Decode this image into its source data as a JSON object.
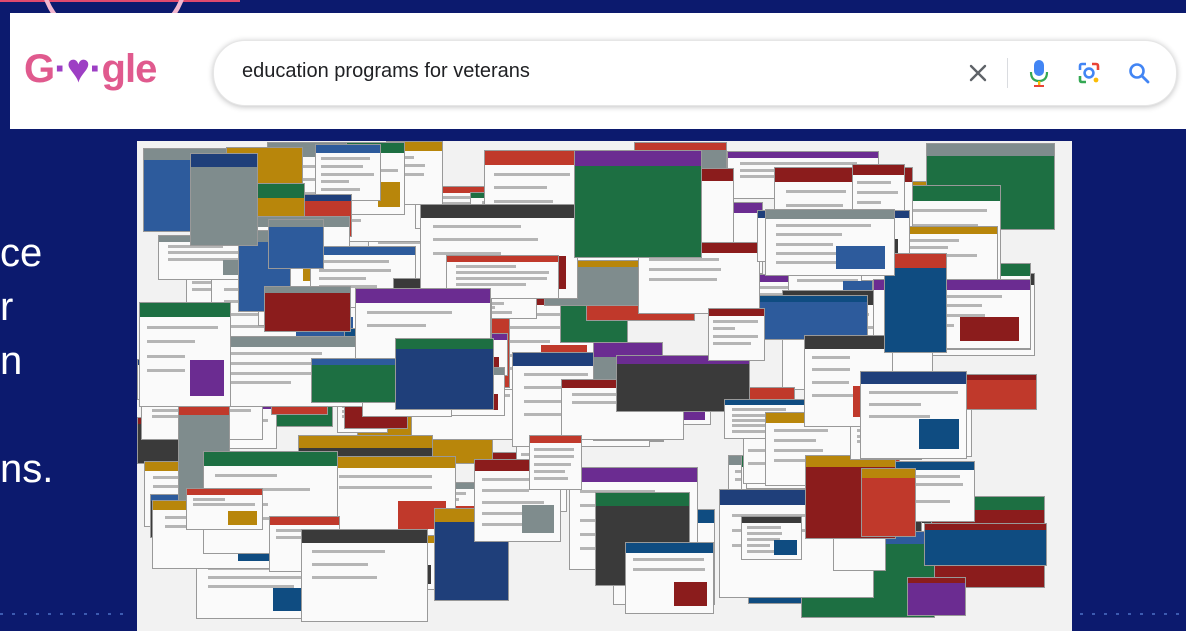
{
  "brand": {
    "logo_text": "Google"
  },
  "search": {
    "query": "education programs for veterans"
  },
  "icons": {
    "clear": "close-icon",
    "voice": "microphone-icon",
    "lens": "camera-lens-icon",
    "search": "search-icon"
  },
  "slide": {
    "text_fragments": [
      "ce",
      "r",
      "n",
      "",
      "ns."
    ],
    "collage_description_count": 0
  },
  "colors": {
    "background": "#0c1a6e",
    "logo_pink": "#e05a8e",
    "logo_purple": "#9d3fc4",
    "google_blue": "#4285f4",
    "google_red": "#ea4335",
    "google_yellow": "#fbbc05",
    "google_green": "#34a853"
  }
}
